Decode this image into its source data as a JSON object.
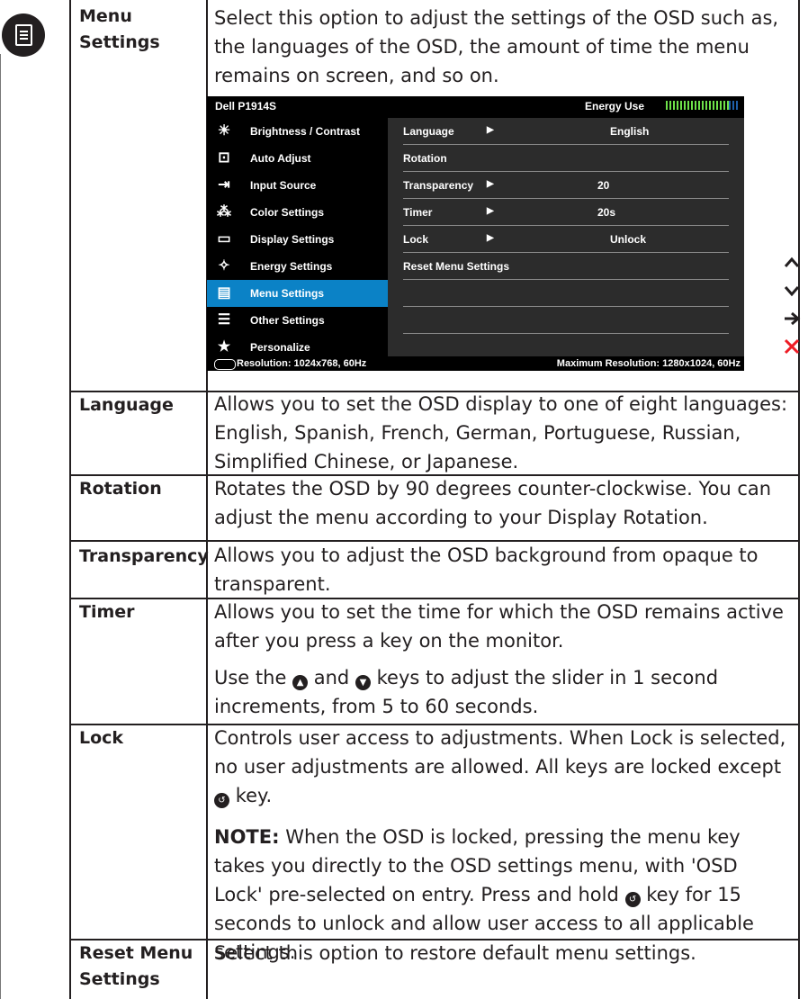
{
  "section_icon": "menu-settings-icon",
  "rows": [
    {
      "label": "Menu Settings",
      "description": "Select this option to adjust the settings of the OSD such as, the languages of the OSD, the amount of time the menu remains on screen, and so on."
    },
    {
      "label": "Language",
      "description": "Allows you to set the OSD display to one of eight languages: English, Spanish, French, German, Portuguese, Russian, Simplified Chinese, or Japanese."
    },
    {
      "label": "Rotation",
      "description": "Rotates the OSD by 90 degrees counter-clockwise. You can adjust the menu according to your Display Rotation."
    },
    {
      "label": "Transparency",
      "description": "Allows you to adjust the OSD background from opaque to transparent."
    },
    {
      "label": "Timer",
      "description": "Allows you to set the time for which the OSD remains active after you press a key on the monitor.",
      "description2_a": "Use the",
      "description2_b": "and",
      "description2_c": "keys to adjust the slider in 1 second increments, from 5 to 60 seconds."
    },
    {
      "label": "Lock",
      "description_a": "Controls user access to adjustments. When Lock is selected, no user adjustments are allowed. All keys are locked except",
      "description_b": "key.",
      "note_label": "NOTE:",
      "note_a": "When the OSD is locked, pressing the menu key takes you directly to the OSD settings menu, with 'OSD Lock' pre-selected on entry. Press and hold",
      "note_b": "key for 15 seconds to unlock and allow user access to all applicable settings."
    },
    {
      "label": "Reset Menu Settings",
      "description": "Select this option to restore default menu settings."
    }
  ],
  "osd": {
    "model": "Dell P1914S",
    "energy_label": "Energy Use",
    "energy_level": 0.85,
    "menu": [
      {
        "icon": "brightness-icon",
        "glyph": "☀",
        "label": "Brightness / Contrast"
      },
      {
        "icon": "auto-adjust-icon",
        "glyph": "⊡",
        "label": "Auto Adjust"
      },
      {
        "icon": "input-source-icon",
        "glyph": "⇥",
        "label": "Input Source"
      },
      {
        "icon": "color-settings-icon",
        "glyph": "⁂",
        "label": "Color Settings"
      },
      {
        "icon": "display-settings-icon",
        "glyph": "▭",
        "label": "Display Settings"
      },
      {
        "icon": "energy-settings-icon",
        "glyph": "✧",
        "label": "Energy Settings"
      },
      {
        "icon": "menu-settings-icon",
        "glyph": "▤",
        "label": "Menu Settings"
      },
      {
        "icon": "other-settings-icon",
        "glyph": "☰",
        "label": "Other Settings"
      },
      {
        "icon": "personalize-icon",
        "glyph": "★",
        "label": "Personalize"
      }
    ],
    "selected_menu": "Menu Settings",
    "options": [
      {
        "name": "Language",
        "arrow": "▶",
        "value": "English"
      },
      {
        "name": "Rotation",
        "arrow": "",
        "value": ""
      },
      {
        "name": "Transparency",
        "arrow": "▶",
        "value": "20"
      },
      {
        "name": "Timer",
        "arrow": "▶",
        "value": "20s"
      },
      {
        "name": "Lock",
        "arrow": "▶",
        "value": "Unlock"
      },
      {
        "name": "Reset Menu Settings",
        "arrow": "",
        "value": ""
      },
      {
        "name": "",
        "arrow": "",
        "value": ""
      },
      {
        "name": "",
        "arrow": "",
        "value": ""
      },
      {
        "name": "",
        "arrow": "",
        "value": ""
      }
    ],
    "resolution": "Resolution: 1024x768,  60Hz",
    "max_resolution": "Maximum Resolution: 1280x1024,  60Hz"
  },
  "nav_keys": [
    {
      "icon": "up-arrow-icon",
      "glyph": "^",
      "color": "#231f20"
    },
    {
      "icon": "down-arrow-icon",
      "glyph": "v",
      "color": "#231f20"
    },
    {
      "icon": "right-arrow-icon",
      "glyph": "→",
      "color": "#231f20"
    },
    {
      "icon": "close-icon",
      "glyph": "✕",
      "color": "#ee1c25"
    }
  ],
  "key_icons": {
    "up": "▲",
    "down": "▼",
    "back": "↺"
  }
}
